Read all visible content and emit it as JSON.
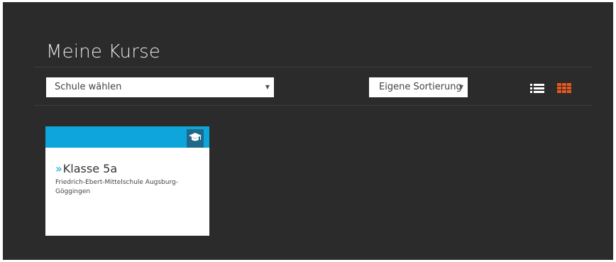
{
  "page": {
    "title": "Meine Kurse"
  },
  "filters": {
    "school_select": {
      "value": "Schule wählen"
    },
    "sort_select": {
      "value": "Eigene Sortierung"
    }
  },
  "view_toggle": {
    "list_icon": "list-view-icon",
    "grid_icon": "grid-view-icon",
    "active": "grid",
    "active_color": "#e8581c"
  },
  "courses": [
    {
      "name": "Klasse 5a",
      "school": "Friedrich-Ebert-Mittelschule Augsburg-Göggingen",
      "header_color": "#0ea5dc",
      "icon": "graduation-cap-icon"
    }
  ]
}
